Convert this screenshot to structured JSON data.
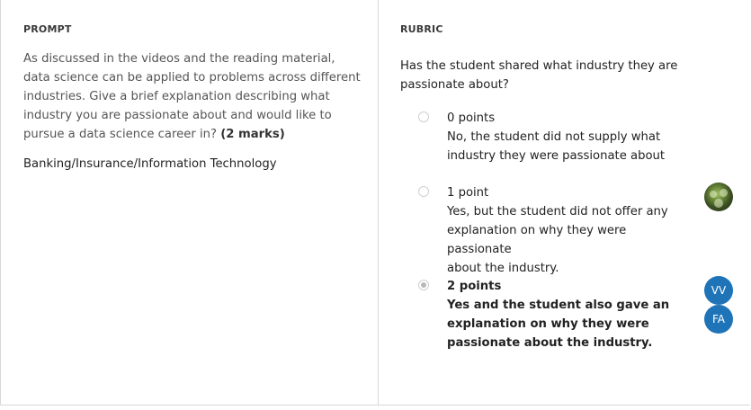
{
  "prompt": {
    "label": "PROMPT",
    "question_lines": [
      "As discussed in the videos and the reading material,",
      "data science can be applied to problems across different",
      "industries. Give a brief explanation describing what",
      "industry  you are passionate about and would like to",
      "pursue a data science career in? "
    ],
    "marks": "(2 marks)",
    "answer": "Banking/Insurance/Information Technology"
  },
  "rubric": {
    "label": "RUBRIC",
    "question_lines": [
      "Has the student shared what industry they are",
      "passionate about?"
    ],
    "options": [
      {
        "points": "0 points",
        "description_lines": [
          "No, the student did not supply what",
          "industry they were passionate about"
        ],
        "selected": false
      },
      {
        "points": "1 point",
        "description_lines": [
          "Yes, but the student did not offer any",
          "explanation on why they were passionate",
          "about the industry."
        ],
        "selected": false
      },
      {
        "points": "2 points",
        "description_lines": [
          "Yes and the student also gave an",
          "explanation on why they were",
          "passionate about the industry."
        ],
        "selected": true
      }
    ]
  },
  "graders": [
    {
      "type": "photo",
      "name": "photo-avatar"
    },
    {
      "type": "initials",
      "initials": "VV"
    },
    {
      "type": "initials",
      "initials": "FA"
    }
  ],
  "colors": {
    "avatar_blue": "#1f74b8",
    "border": "#d9d9d9",
    "prompt_text": "#555555"
  }
}
